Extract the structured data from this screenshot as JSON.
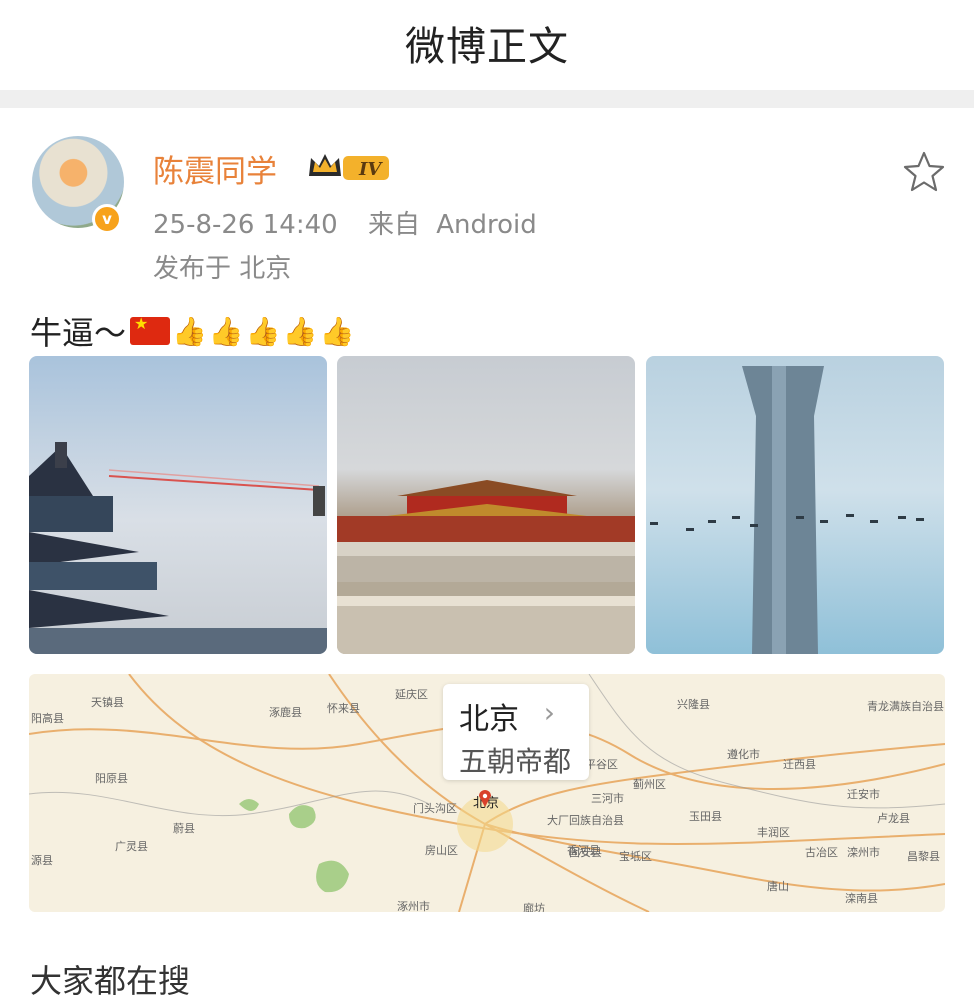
{
  "header": {
    "title": "微博正文"
  },
  "post": {
    "author": {
      "name": "陈震同学",
      "level_badge": "IV"
    },
    "meta": {
      "time": "25-8-26 14:40",
      "source_prefix": "来自",
      "source": "Android"
    },
    "location_label": "发布于 北京",
    "text": "牛逼～"
  },
  "map": {
    "title": "北京",
    "subtitle": "五朝帝都",
    "labels": [
      "天镇县",
      "怀来县",
      "延庆区",
      "涿鹿县",
      "阳原县",
      "广灵县",
      "蔚县",
      "门头沟区",
      "房山区",
      "北京",
      "涿州市",
      "固安县",
      "廊坊",
      "三河市",
      "平谷区",
      "兴隆县",
      "遵化市",
      "迁西县",
      "蓟州区",
      "玉田县",
      "丰润区",
      "古冶区",
      "唐山",
      "滦州市",
      "迁安市",
      "卢龙县",
      "滦南县",
      "青龙满族自治县",
      "宝坻区",
      "香河县",
      "大厂回族自治县",
      "昌黎县",
      "源县",
      "阳高县"
    ]
  },
  "bottom_text": "大家都在搜"
}
